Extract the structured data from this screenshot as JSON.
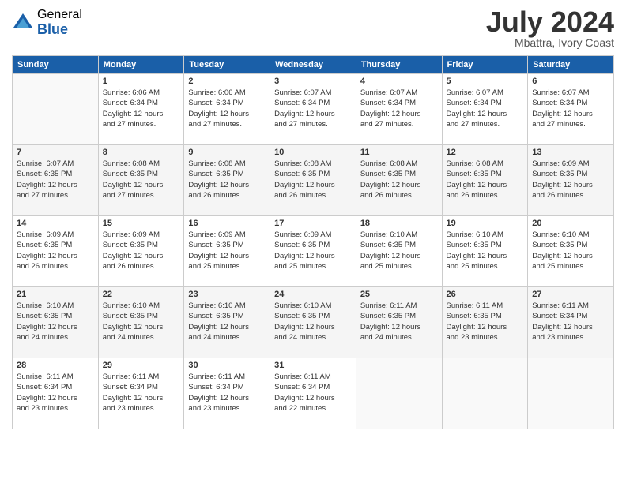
{
  "logo": {
    "general": "General",
    "blue": "Blue"
  },
  "title": "July 2024",
  "location": "Mbattra, Ivory Coast",
  "days_of_week": [
    "Sunday",
    "Monday",
    "Tuesday",
    "Wednesday",
    "Thursday",
    "Friday",
    "Saturday"
  ],
  "weeks": [
    [
      {
        "day": "",
        "info": ""
      },
      {
        "day": "1",
        "info": "Sunrise: 6:06 AM\nSunset: 6:34 PM\nDaylight: 12 hours\nand 27 minutes."
      },
      {
        "day": "2",
        "info": "Sunrise: 6:06 AM\nSunset: 6:34 PM\nDaylight: 12 hours\nand 27 minutes."
      },
      {
        "day": "3",
        "info": "Sunrise: 6:07 AM\nSunset: 6:34 PM\nDaylight: 12 hours\nand 27 minutes."
      },
      {
        "day": "4",
        "info": "Sunrise: 6:07 AM\nSunset: 6:34 PM\nDaylight: 12 hours\nand 27 minutes."
      },
      {
        "day": "5",
        "info": "Sunrise: 6:07 AM\nSunset: 6:34 PM\nDaylight: 12 hours\nand 27 minutes."
      },
      {
        "day": "6",
        "info": "Sunrise: 6:07 AM\nSunset: 6:34 PM\nDaylight: 12 hours\nand 27 minutes."
      }
    ],
    [
      {
        "day": "7",
        "info": ""
      },
      {
        "day": "8",
        "info": "Sunrise: 6:08 AM\nSunset: 6:35 PM\nDaylight: 12 hours\nand 27 minutes."
      },
      {
        "day": "9",
        "info": "Sunrise: 6:08 AM\nSunset: 6:35 PM\nDaylight: 12 hours\nand 26 minutes."
      },
      {
        "day": "10",
        "info": "Sunrise: 6:08 AM\nSunset: 6:35 PM\nDaylight: 12 hours\nand 26 minutes."
      },
      {
        "day": "11",
        "info": "Sunrise: 6:08 AM\nSunset: 6:35 PM\nDaylight: 12 hours\nand 26 minutes."
      },
      {
        "day": "12",
        "info": "Sunrise: 6:08 AM\nSunset: 6:35 PM\nDaylight: 12 hours\nand 26 minutes."
      },
      {
        "day": "13",
        "info": "Sunrise: 6:09 AM\nSunset: 6:35 PM\nDaylight: 12 hours\nand 26 minutes."
      }
    ],
    [
      {
        "day": "14",
        "info": ""
      },
      {
        "day": "15",
        "info": "Sunrise: 6:09 AM\nSunset: 6:35 PM\nDaylight: 12 hours\nand 26 minutes."
      },
      {
        "day": "16",
        "info": "Sunrise: 6:09 AM\nSunset: 6:35 PM\nDaylight: 12 hours\nand 25 minutes."
      },
      {
        "day": "17",
        "info": "Sunrise: 6:09 AM\nSunset: 6:35 PM\nDaylight: 12 hours\nand 25 minutes."
      },
      {
        "day": "18",
        "info": "Sunrise: 6:10 AM\nSunset: 6:35 PM\nDaylight: 12 hours\nand 25 minutes."
      },
      {
        "day": "19",
        "info": "Sunrise: 6:10 AM\nSunset: 6:35 PM\nDaylight: 12 hours\nand 25 minutes."
      },
      {
        "day": "20",
        "info": "Sunrise: 6:10 AM\nSunset: 6:35 PM\nDaylight: 12 hours\nand 25 minutes."
      }
    ],
    [
      {
        "day": "21",
        "info": ""
      },
      {
        "day": "22",
        "info": "Sunrise: 6:10 AM\nSunset: 6:35 PM\nDaylight: 12 hours\nand 24 minutes."
      },
      {
        "day": "23",
        "info": "Sunrise: 6:10 AM\nSunset: 6:35 PM\nDaylight: 12 hours\nand 24 minutes."
      },
      {
        "day": "24",
        "info": "Sunrise: 6:10 AM\nSunset: 6:35 PM\nDaylight: 12 hours\nand 24 minutes."
      },
      {
        "day": "25",
        "info": "Sunrise: 6:11 AM\nSunset: 6:35 PM\nDaylight: 12 hours\nand 24 minutes."
      },
      {
        "day": "26",
        "info": "Sunrise: 6:11 AM\nSunset: 6:35 PM\nDaylight: 12 hours\nand 23 minutes."
      },
      {
        "day": "27",
        "info": "Sunrise: 6:11 AM\nSunset: 6:34 PM\nDaylight: 12 hours\nand 23 minutes."
      }
    ],
    [
      {
        "day": "28",
        "info": "Sunrise: 6:11 AM\nSunset: 6:34 PM\nDaylight: 12 hours\nand 23 minutes."
      },
      {
        "day": "29",
        "info": "Sunrise: 6:11 AM\nSunset: 6:34 PM\nDaylight: 12 hours\nand 23 minutes."
      },
      {
        "day": "30",
        "info": "Sunrise: 6:11 AM\nSunset: 6:34 PM\nDaylight: 12 hours\nand 23 minutes."
      },
      {
        "day": "31",
        "info": "Sunrise: 6:11 AM\nSunset: 6:34 PM\nDaylight: 12 hours\nand 22 minutes."
      },
      {
        "day": "",
        "info": ""
      },
      {
        "day": "",
        "info": ""
      },
      {
        "day": "",
        "info": ""
      }
    ]
  ],
  "week1_day7_info": "Sunrise: 6:07 AM\nSunset: 6:35 PM\nDaylight: 12 hours\nand 27 minutes.",
  "week2_day7_info": "Sunrise: 6:08 AM\nSunset: 6:35 PM\nDaylight: 12 hours\nand 27 minutes.",
  "week3_day14_info": "Sunrise: 6:09 AM\nSunset: 6:35 PM\nDaylight: 12 hours\nand 26 minutes.",
  "week4_day21_info": "Sunrise: 6:10 AM\nSunset: 6:35 PM\nDaylight: 12 hours\nand 24 minutes."
}
